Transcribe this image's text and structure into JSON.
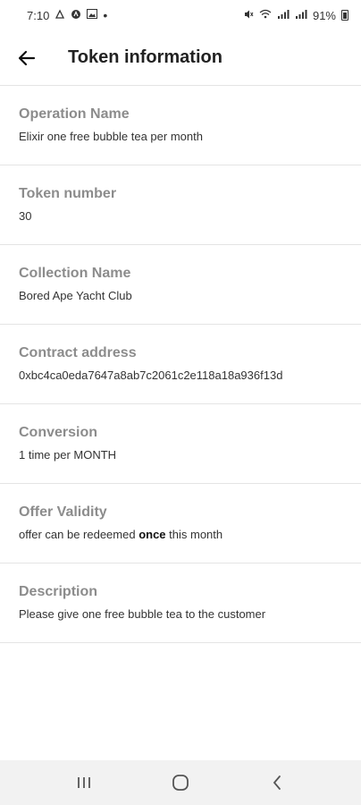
{
  "status_bar": {
    "time": "7:10",
    "battery": "91%"
  },
  "header": {
    "title": "Token information"
  },
  "fields": [
    {
      "label": "Operation Name",
      "value": "Elixir one free bubble tea per month"
    },
    {
      "label": "Token number",
      "value": "30"
    },
    {
      "label": "Collection Name",
      "value": "Bored Ape Yacht Club"
    },
    {
      "label": "Contract address",
      "value": "0xbc4ca0eda7647a8ab7c2061c2e118a18a936f13d"
    },
    {
      "label": "Conversion",
      "value": "1 time per MONTH"
    },
    {
      "label": "Offer Validity",
      "value_prefix": "offer can be redeemed ",
      "value_bold": "once",
      "value_suffix": " this month"
    },
    {
      "label": "Description",
      "value": "Please give one free bubble tea to the customer"
    }
  ],
  "icons": {
    "back": "arrow-left-icon",
    "recents": "recents-icon",
    "home": "home-icon",
    "nav_back": "chevron-left-icon"
  }
}
